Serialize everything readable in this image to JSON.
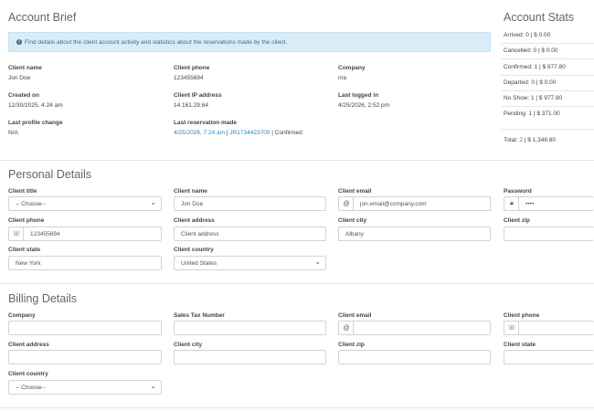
{
  "brief": {
    "title": "Account Brief",
    "info": "Find details about the client account activity and statistics about the reservations made by the client.",
    "client_name_label": "Client name",
    "client_name": "Jon Doe",
    "client_phone_label": "Client phone",
    "client_phone": "123455694",
    "company_label": "Company",
    "company": "n/a",
    "created_label": "Created on",
    "created": "12/30/2025, 4:24 am",
    "ip_label": "Client IP address",
    "ip": "14.161.29.64",
    "last_login_label": "Last logged in",
    "last_login": "4/25/2026, 2:52 pm",
    "profile_change_label": "Last profile change",
    "profile_change": "N/A",
    "last_res_label": "Last reservation made",
    "last_res_date": "4/25/2026, 7:24 am",
    "last_res_sep1": " | ",
    "last_res_id": "JR1734423700",
    "last_res_sep2": " | ",
    "last_res_status": "Confirmed"
  },
  "stats": {
    "title": "Account Stats",
    "arrived": "Arrived: 0 | $ 0.00",
    "cancelled": "Cancelled: 0 | $ 0.00",
    "confirmed": "Confirmed: 1 | $ 977.80",
    "departed": "Departed: 0 | $ 0.00",
    "no_show": "No Show: 1 | $ 977.80",
    "pending": "Pending: 1 | $ 371.00",
    "total_prefix": "Total: ",
    "total_count": "2",
    "total_rest": " | $ 1,348.80"
  },
  "personal": {
    "title": "Personal Details",
    "title_label": "Client title",
    "title_value": "-- Choose--",
    "name_label": "Client name",
    "name_value": "Jon Doe",
    "email_label": "Client email",
    "email_value": "jon.email@company.com",
    "password_label": "Password",
    "password_value": "••••",
    "phone_label": "Client phone",
    "phone_value": "123455694",
    "address_label": "Client address",
    "address_placeholder": "Client address",
    "city_label": "Client city",
    "city_value": "Albany",
    "zip_label": "Client zip",
    "state_label": "Client state",
    "state_value": "New York",
    "country_label": "Client country",
    "country_value": "United States"
  },
  "billing": {
    "title": "Billing Details",
    "company_label": "Company",
    "tax_label": "Sales Tax Number",
    "email_label": "Client email",
    "phone_label": "Client phone",
    "address_label": "Client address",
    "city_label": "Client city",
    "zip_label": "Client zip",
    "state_label": "Client state",
    "country_label": "Client country",
    "country_value": "-- Choose--"
  },
  "icons": {
    "info": "info-circle-icon",
    "at": "at-icon",
    "lock": "lock-icon",
    "phone": "phone-icon"
  }
}
